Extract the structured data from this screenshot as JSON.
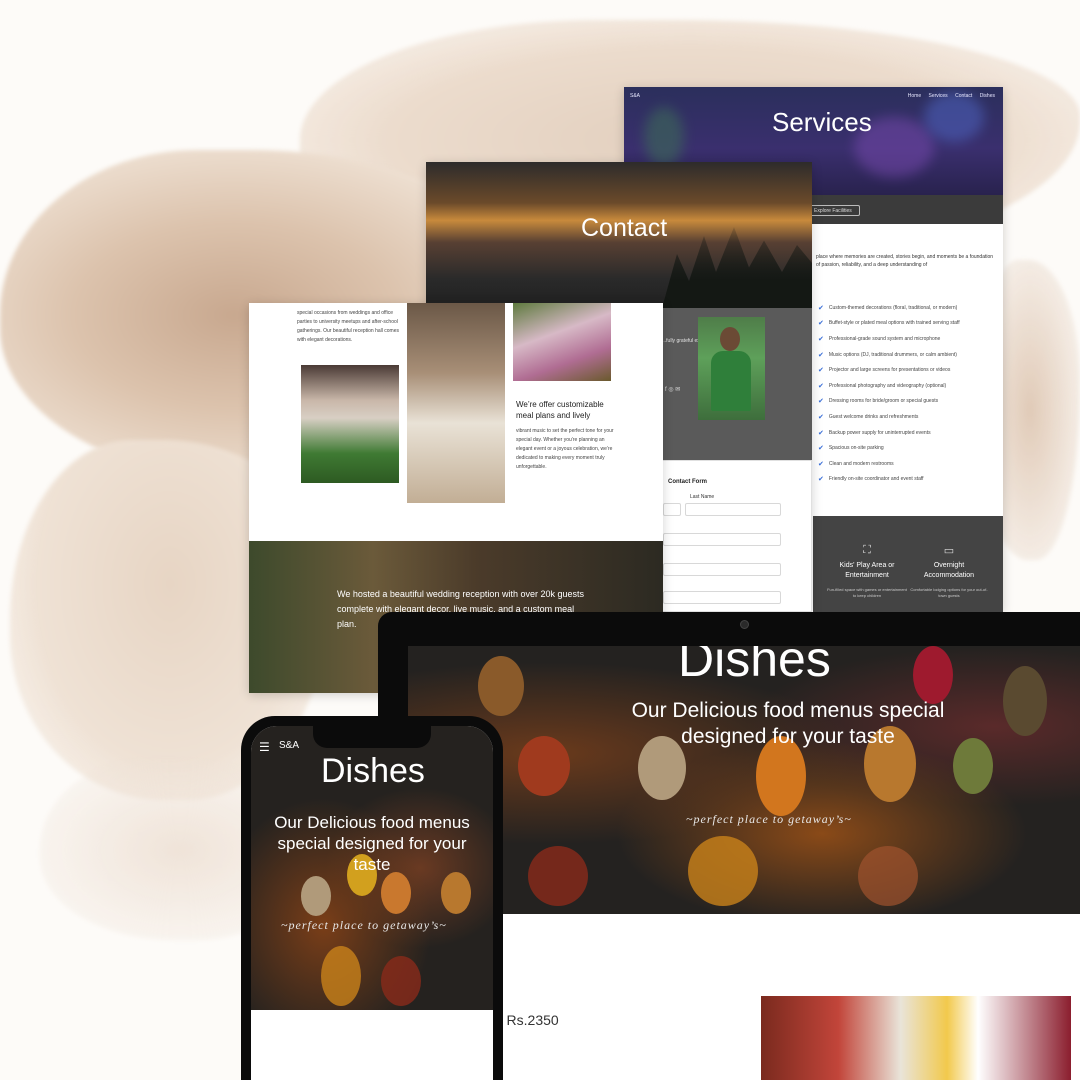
{
  "services_page": {
    "brand": "S&A",
    "nav": [
      "Home",
      "Services",
      "Contact",
      "Dishes"
    ],
    "title": "Services",
    "button": "Explore Facilities",
    "intro": "place where memories are created, stories begin, and moments be a foundation of passion, reliability, and a deep understanding of",
    "features": [
      "Custom-themed decorations (floral, traditional, or modern)",
      "Buffet-style or plated meal options with trained serving staff",
      "Professional-grade sound system and microphone",
      "Music options (DJ, traditional drummers, or calm ambient)",
      "Projector and large screens for presentations or videos",
      "Professional photography and videography (optional)",
      "Dressing rooms for bride/groom or special guests",
      "Guest welcome drinks and refreshments",
      "Backup power supply for uninterrupted events",
      "Spacious on-site parking",
      "Clean and modern restrooms",
      "Friendly on-site coordinator and event staff"
    ],
    "amenities": [
      {
        "title": "Kids' Play Area or Entertainment",
        "desc": "Fun-filled space with games or entertainment to keep children",
        "icon": "kids-icon"
      },
      {
        "title": "Overnight Accommodation",
        "desc": "Comfortable lodging options for your out-of-town guests",
        "icon": "bed-icon"
      }
    ]
  },
  "contact_page": {
    "title": "Contact",
    "side_text": "...fully grateful experience with ...nfully",
    "social": [
      "f",
      "◎",
      "✉"
    ],
    "form_title": "Contact Form",
    "last_name_label": "Last Name"
  },
  "gallery_page": {
    "intro": "special occasions from weddings and office parties to university meetups and after-school gatherings. Our beautiful reception hall comes with elegant decorations.",
    "caption_heading": "We’re offer customizable meal plans and lively",
    "caption_text": "vibrant music to set the perfect tone for your special day. Whether you’re planning an elegant event or a joyous celebration, we’re dedicated to making every moment truly unforgettable.",
    "band_text": "We hosted a beautiful wedding reception with over 20k guests complete with elegant decor, live music, and a custom meal plan."
  },
  "laptop_page": {
    "title": "Dishes",
    "subtitle": "Our Delicious food menus special designed for your taste",
    "tagline": "~perfect place to getaway’s~",
    "price": "- Rs.2350"
  },
  "phone_page": {
    "brand": "S&A",
    "menu_icon": "☰",
    "title": "Dishes",
    "subtitle": "Our Delicious food menus special designed for your taste",
    "tagline": "~perfect place to getaway’s~"
  },
  "colors": {
    "accent_check": "#3a6fd8",
    "dark_panel": "#444444",
    "device_frame": "#0b0b0b"
  }
}
